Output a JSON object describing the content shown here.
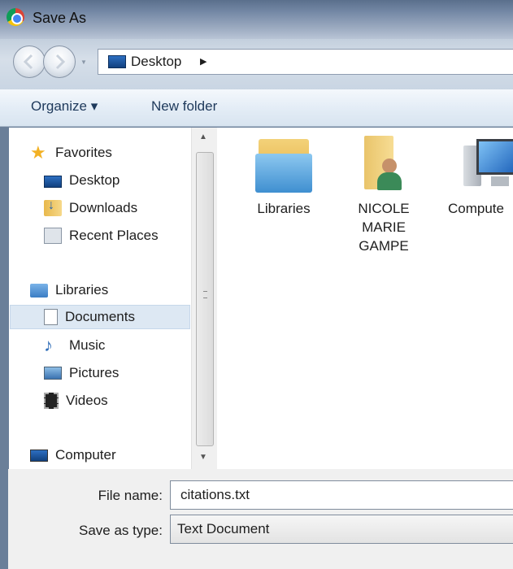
{
  "window": {
    "title": "Save As",
    "title_icon": "chrome-icon"
  },
  "navigation": {
    "back_icon": "back-arrow-icon",
    "forward_icon": "forward-arrow-icon",
    "address": {
      "location": "Desktop",
      "icon": "desktop-icon"
    }
  },
  "toolbar": {
    "organize_label": "Organize ▾",
    "new_folder_label": "New folder"
  },
  "nav_pane": {
    "favorites": {
      "label": "Favorites",
      "items": [
        {
          "label": "Desktop",
          "icon": "desktop-icon"
        },
        {
          "label": "Downloads",
          "icon": "downloads-icon"
        },
        {
          "label": "Recent Places",
          "icon": "recent-places-icon"
        }
      ]
    },
    "libraries": {
      "label": "Libraries",
      "items": [
        {
          "label": "Documents",
          "icon": "documents-icon",
          "selected": true
        },
        {
          "label": "Music",
          "icon": "music-icon"
        },
        {
          "label": "Pictures",
          "icon": "pictures-icon"
        },
        {
          "label": "Videos",
          "icon": "videos-icon"
        }
      ]
    },
    "computer": {
      "label": "Computer",
      "icon": "computer-icon"
    }
  },
  "content": {
    "items": [
      {
        "label": "Libraries",
        "icon": "libraries-folder-icon"
      },
      {
        "label_lines": [
          "NICOLE",
          "MARIE",
          "GAMPE"
        ],
        "icon": "user-folder-icon"
      },
      {
        "label": "Compute",
        "icon": "computer-icon"
      }
    ]
  },
  "footer": {
    "file_name_label": "File name:",
    "file_name_value": "citations.txt",
    "save_type_label": "Save as type:",
    "save_type_value": "Text Document"
  }
}
